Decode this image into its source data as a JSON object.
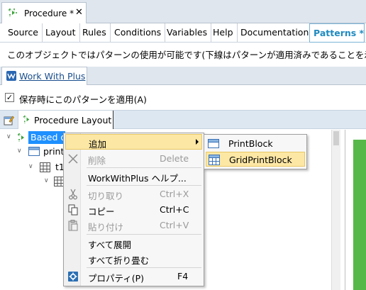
{
  "document_tab": {
    "title": "Procedure *",
    "close": "✕"
  },
  "editor_tabs": [
    "Source",
    "Layout",
    "Rules",
    "Conditions",
    "Variables",
    "Help",
    "Documentation",
    "Patterns *"
  ],
  "info_text": "このオブジェクトではパターンの使用が可能です(下線はパターンが適用済みであることを示し",
  "pattern_tab": {
    "label": "Work With Plus"
  },
  "apply_on_save": {
    "checked": true,
    "label": "保存時にこのパターンを適用(A)",
    "check_glyph": "✓"
  },
  "layout_tab": {
    "label": "Procedure Layout"
  },
  "tree": {
    "root_label": "Based o",
    "child1": "print",
    "child2": "t1"
  },
  "context_menu": {
    "items": [
      {
        "label": "追加",
        "shortcut": "",
        "disabled": false,
        "submenu": true
      },
      {
        "label": "削除",
        "shortcut": "Delete",
        "disabled": true
      },
      {
        "label": "WorkWithPlus ヘルプ...",
        "shortcut": "",
        "disabled": false
      },
      {
        "label": "切り取り",
        "shortcut": "Ctrl+X",
        "disabled": true
      },
      {
        "label": "コピー",
        "shortcut": "Ctrl+C",
        "disabled": false
      },
      {
        "label": "貼り付け",
        "shortcut": "Ctrl+V",
        "disabled": true
      },
      {
        "label": "すべて展開",
        "shortcut": "",
        "disabled": false
      },
      {
        "label": "すべて折り畳む",
        "shortcut": "",
        "disabled": false
      },
      {
        "label": "プロパティ(P)",
        "shortcut": "F4",
        "disabled": false
      }
    ]
  },
  "submenu": {
    "items": [
      "PrintBlock",
      "GridPrintBlock"
    ]
  }
}
